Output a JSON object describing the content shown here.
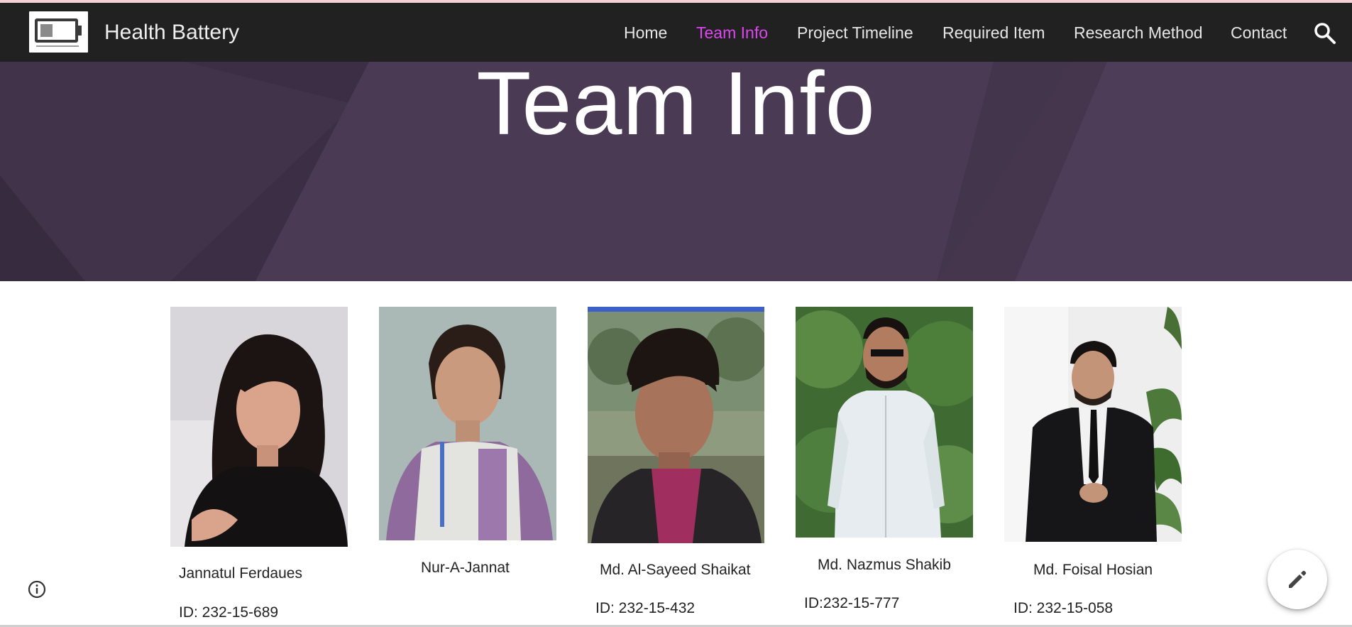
{
  "site": {
    "title": "Health Battery",
    "logo_icon": "battery-icon"
  },
  "nav": {
    "items": [
      {
        "label": "Home",
        "active": false
      },
      {
        "label": "Team Info",
        "active": true
      },
      {
        "label": "Project Timeline",
        "active": false
      },
      {
        "label": "Required Item",
        "active": false
      },
      {
        "label": "Research Method",
        "active": false
      },
      {
        "label": "Contact",
        "active": false
      }
    ],
    "active_color": "#dc47ef",
    "search_icon": "search-icon"
  },
  "hero": {
    "title": "Team Info",
    "background_color": "#46364f"
  },
  "team": {
    "members": [
      {
        "name": "Jannatul Ferdaues",
        "id": "ID: 232-15-689"
      },
      {
        "name": "Nur-A-Jannat",
        "id": ""
      },
      {
        "name": "Md. Al-Sayeed Shaikat",
        "id": "ID: 232-15-432"
      },
      {
        "name": "Md. Nazmus Shakib",
        "id": "ID:232-15-777"
      },
      {
        "name": "Md. Foisal Hosian",
        "id": "ID: 232-15-058"
      }
    ]
  },
  "controls": {
    "info_icon": "info-icon",
    "edit_icon": "pencil-icon"
  }
}
